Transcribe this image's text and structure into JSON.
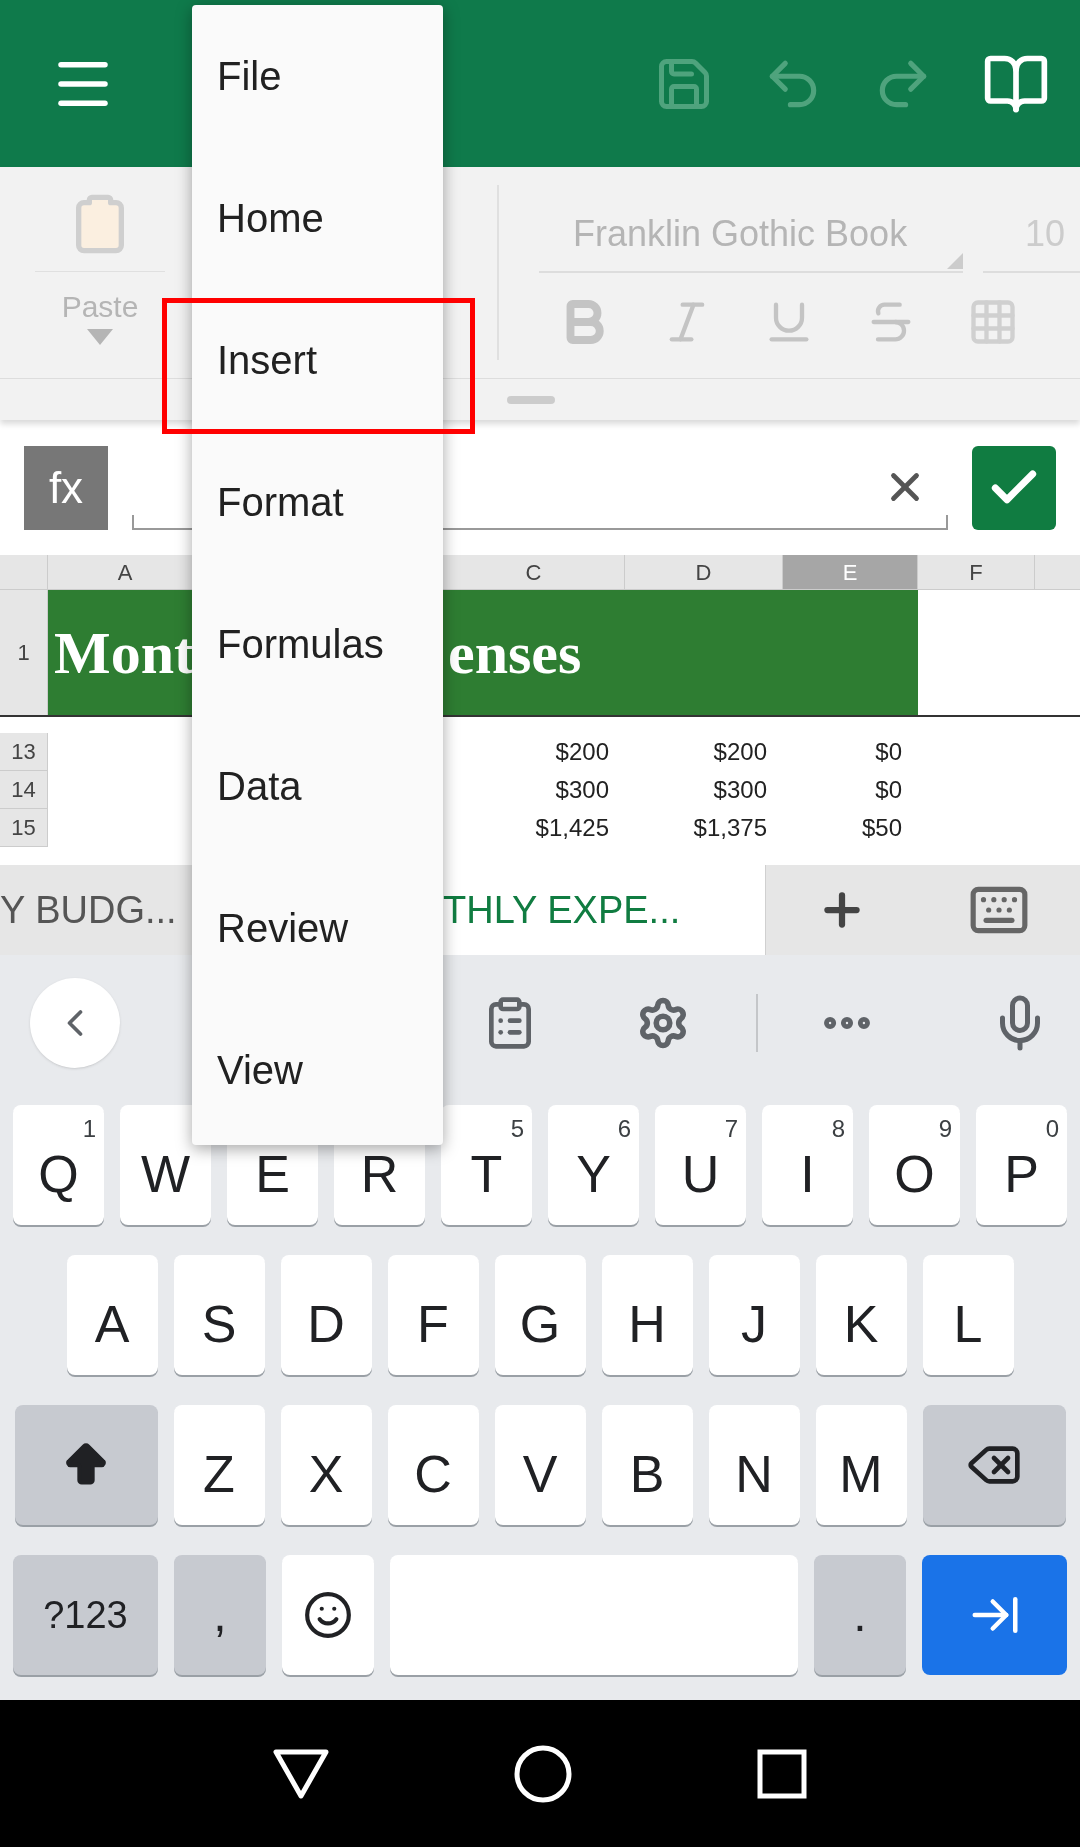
{
  "ribbon": {
    "paste_label": "Paste",
    "font_name": "Franklin Gothic Book",
    "font_size": "10"
  },
  "formula_bar": {
    "label": "fx"
  },
  "columns": [
    {
      "label": "A",
      "selected": false
    },
    {
      "label": "C",
      "selected": false
    },
    {
      "label": "D",
      "selected": false
    },
    {
      "label": "E",
      "selected": true
    },
    {
      "label": "F",
      "selected": false
    }
  ],
  "title_row": {
    "row": "1",
    "text_left": "Mont",
    "text_right": "enses"
  },
  "rows": [
    {
      "row": "13",
      "cells": [
        "$200",
        "$200",
        "$0"
      ]
    },
    {
      "row": "14",
      "cells": [
        "$300",
        "$300",
        "$0"
      ]
    },
    {
      "row": "15",
      "cells": [
        "$1,425",
        "$1,375",
        "$50"
      ]
    }
  ],
  "sheet_tabs": [
    {
      "label": "Y BUDG...",
      "selected": false
    },
    {
      "label": "THLY EXPE...",
      "selected": true
    }
  ],
  "menu": {
    "items": [
      {
        "label": "File",
        "highlighted": false
      },
      {
        "label": "Home",
        "highlighted": false
      },
      {
        "label": "Insert",
        "highlighted": true
      },
      {
        "label": "Format",
        "highlighted": false
      },
      {
        "label": "Formulas",
        "highlighted": false
      },
      {
        "label": "Data",
        "highlighted": false
      },
      {
        "label": "Review",
        "highlighted": false
      },
      {
        "label": "View",
        "highlighted": false
      }
    ]
  },
  "keyboard": {
    "rows": [
      {
        "keys": [
          {
            "kind": "letter",
            "label": "Q",
            "hint": "1"
          },
          {
            "kind": "letter",
            "label": "W"
          },
          {
            "kind": "letter",
            "label": "E"
          },
          {
            "kind": "letter",
            "label": "R"
          },
          {
            "kind": "letter",
            "label": "T",
            "hint": "5"
          },
          {
            "kind": "letter",
            "label": "Y",
            "hint": "6"
          },
          {
            "kind": "letter",
            "label": "U",
            "hint": "7"
          },
          {
            "kind": "letter",
            "label": "I",
            "hint": "8"
          },
          {
            "kind": "letter",
            "label": "O",
            "hint": "9"
          },
          {
            "kind": "letter",
            "label": "P",
            "hint": "0"
          }
        ]
      },
      {
        "keys": [
          {
            "kind": "letter",
            "label": "A"
          },
          {
            "kind": "letter",
            "label": "S"
          },
          {
            "kind": "letter",
            "label": "D"
          },
          {
            "kind": "letter",
            "label": "F"
          },
          {
            "kind": "letter",
            "label": "G"
          },
          {
            "kind": "letter",
            "label": "H"
          },
          {
            "kind": "letter",
            "label": "J"
          },
          {
            "kind": "letter",
            "label": "K"
          },
          {
            "kind": "letter",
            "label": "L"
          }
        ]
      },
      {
        "keys": [
          {
            "kind": "shift"
          },
          {
            "kind": "letter",
            "label": "Z"
          },
          {
            "kind": "letter",
            "label": "X"
          },
          {
            "kind": "letter",
            "label": "C"
          },
          {
            "kind": "letter",
            "label": "V"
          },
          {
            "kind": "letter",
            "label": "B"
          },
          {
            "kind": "letter",
            "label": "N"
          },
          {
            "kind": "letter",
            "label": "M"
          },
          {
            "kind": "backspace"
          }
        ]
      },
      {
        "keys": [
          {
            "kind": "symbols",
            "label": "?123"
          },
          {
            "kind": "punct",
            "label": ","
          },
          {
            "kind": "emoji"
          },
          {
            "kind": "space"
          },
          {
            "kind": "punct",
            "label": "."
          },
          {
            "kind": "enter"
          }
        ]
      }
    ]
  }
}
